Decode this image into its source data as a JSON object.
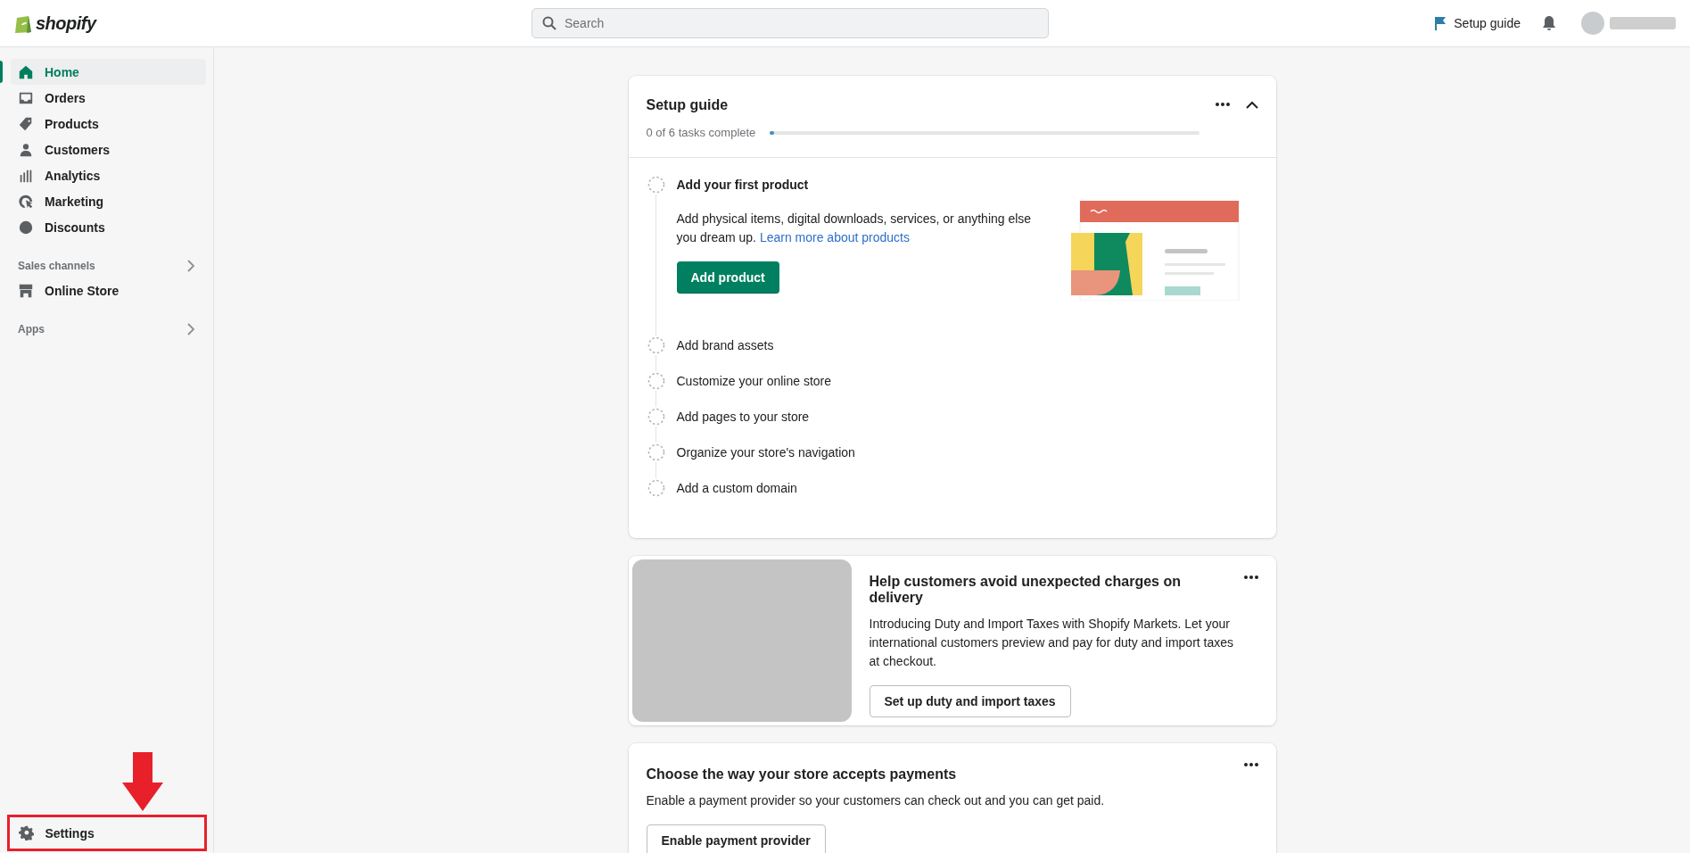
{
  "topbar": {
    "logo": "shopify",
    "search": {
      "placeholder": "Search"
    },
    "setup_link": "Setup guide"
  },
  "sidebar": {
    "items": [
      {
        "label": "Home",
        "selected": true
      },
      {
        "label": "Orders",
        "selected": false
      },
      {
        "label": "Products",
        "selected": false
      },
      {
        "label": "Customers",
        "selected": false
      },
      {
        "label": "Analytics",
        "selected": false
      },
      {
        "label": "Marketing",
        "selected": false
      },
      {
        "label": "Discounts",
        "selected": false
      }
    ],
    "sections": [
      {
        "title": "Sales channels",
        "items": [
          {
            "label": "Online Store",
            "selected": false
          }
        ]
      },
      {
        "title": "Apps"
      }
    ],
    "settings": "Settings"
  },
  "setup_guide": {
    "title": "Setup guide",
    "progress_text": "0 of 6 tasks complete",
    "level": 0.01,
    "tasks": [
      {
        "label": "Add your first product",
        "checked": false,
        "expanded": true,
        "description": "Add physical items, digital downloads, services, or anything else you dream up.",
        "link": "Learn more about products",
        "button": "Add product"
      },
      {
        "label": "Add brand assets",
        "checked": false,
        "expanded": false
      },
      {
        "label": "Customize your online store",
        "checked": false,
        "expanded": false
      },
      {
        "label": "Add pages to your store",
        "checked": false,
        "expanded": false
      },
      {
        "label": "Organize your store's navigation",
        "checked": false,
        "expanded": false
      },
      {
        "label": "Add a custom domain",
        "checked": false,
        "expanded": false
      }
    ]
  },
  "cards": [
    {
      "kind": "media",
      "title": "Help customers avoid unexpected charges on delivery",
      "text": "Introducing Duty and Import Taxes with Shopify Markets. Let your international customers preview and pay for duty and import taxes at checkout.",
      "button": "Set up duty and import taxes"
    },
    {
      "kind": "plain",
      "title": "Choose the way your store accepts payments",
      "text": "Enable a payment provider so your customers can check out and you can get paid.",
      "button": "Enable payment provider"
    }
  ]
}
